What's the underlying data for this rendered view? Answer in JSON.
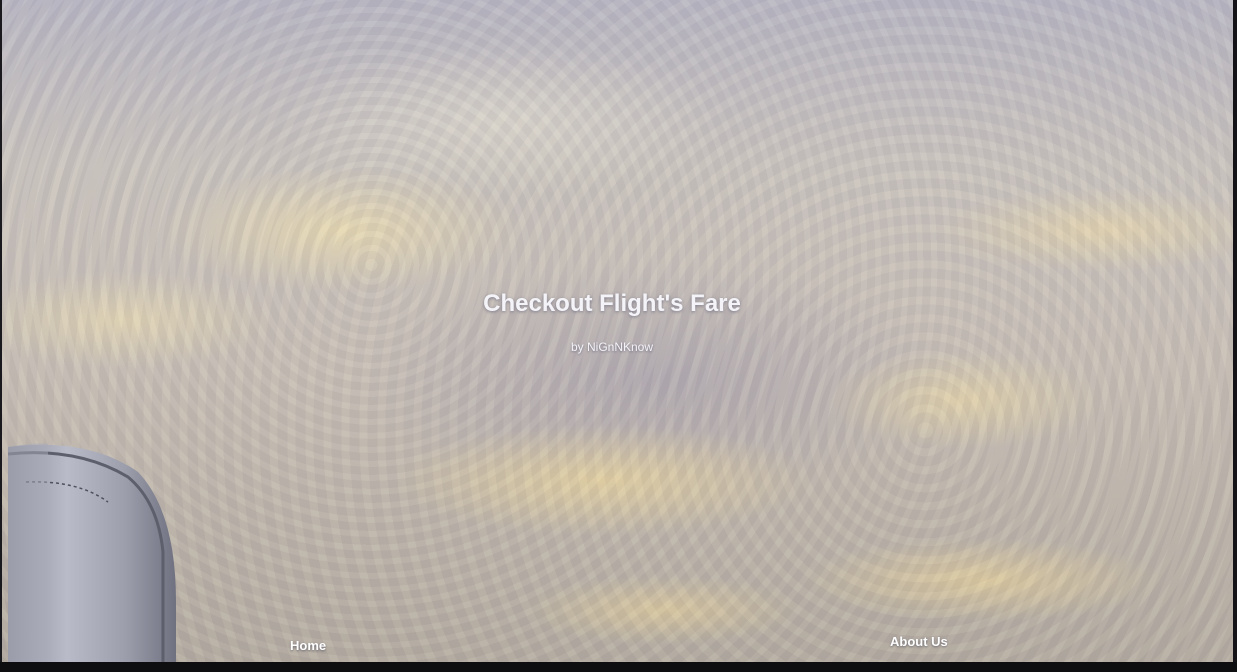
{
  "hero": {
    "title": "Checkout Flight's Fare",
    "subtitle": "by NiGnNKnow"
  },
  "nav": {
    "home_label": "Home",
    "about_label": "About Us"
  },
  "background": {
    "description_icon": "clouds-aerial-photo",
    "engine_icon": "jet-engine-nacelle-icon"
  }
}
